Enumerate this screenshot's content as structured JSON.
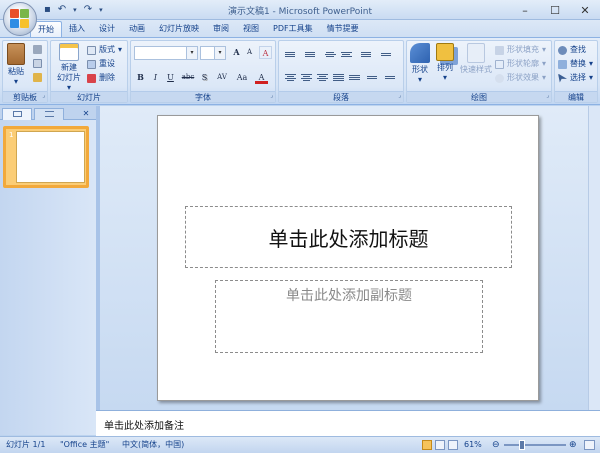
{
  "window": {
    "title": "演示文稿1 - Microsoft PowerPoint",
    "minimize": "–",
    "maximize": "☐",
    "close": "✕"
  },
  "qat": {
    "save": "▪",
    "undo": "↶",
    "undo_drop": "▾",
    "redo": "↷",
    "customize": "▾"
  },
  "tabs": [
    {
      "label": "开始",
      "active": true
    },
    {
      "label": "插入"
    },
    {
      "label": "设计"
    },
    {
      "label": "动画"
    },
    {
      "label": "幻灯片放映"
    },
    {
      "label": "审阅"
    },
    {
      "label": "视图"
    },
    {
      "label": "PDF工具集"
    },
    {
      "label": "情节提要"
    }
  ],
  "ribbon": {
    "clipboard": {
      "label": "剪贴板",
      "paste": "粘贴",
      "paste_arrow": "▾"
    },
    "slides": {
      "label": "幻灯片",
      "new_slide": "新建",
      "new_slide2": "幻灯片",
      "layout": "版式",
      "reset": "重设",
      "delete": "删除"
    },
    "font": {
      "label": "字体",
      "name": "",
      "size": "",
      "grow": "A",
      "shrink": "A",
      "clear": "A",
      "bold": "B",
      "italic": "I",
      "underline": "U",
      "strike": "abc",
      "shadow": "S",
      "spacing": "AV",
      "case": "Aa",
      "color": "A"
    },
    "paragraph": {
      "label": "段落"
    },
    "drawing": {
      "label": "绘图",
      "shapes": "形状",
      "arrange": "排列",
      "quick_styles": "快速样式",
      "fill": "形状填充",
      "outline": "形状轮廓",
      "effects": "形状效果"
    },
    "editing": {
      "label": "编辑",
      "find": "查找",
      "replace": "替换",
      "select": "选择"
    }
  },
  "panel": {
    "tab_outline": "",
    "tab_slides": "",
    "close": "✕",
    "slide_number": "1"
  },
  "slide": {
    "title_placeholder": "单击此处添加标题",
    "subtitle_placeholder": "单击此处添加副标题"
  },
  "notes": {
    "placeholder": "单击此处添加备注"
  },
  "status": {
    "slide_info": "幻灯片 1/1",
    "theme": "\"Office 主题\"",
    "language": "中文(简体，中国)",
    "zoom": "61%",
    "zoom_percent": 61,
    "zoom_out": "⊖",
    "zoom_in": "⊕"
  },
  "colors": {
    "accent": "#15428b",
    "ribbon_bg": "#d6e4f6",
    "thumb_highlight": "#f2a93b",
    "slide_bg": "#ffffff"
  }
}
